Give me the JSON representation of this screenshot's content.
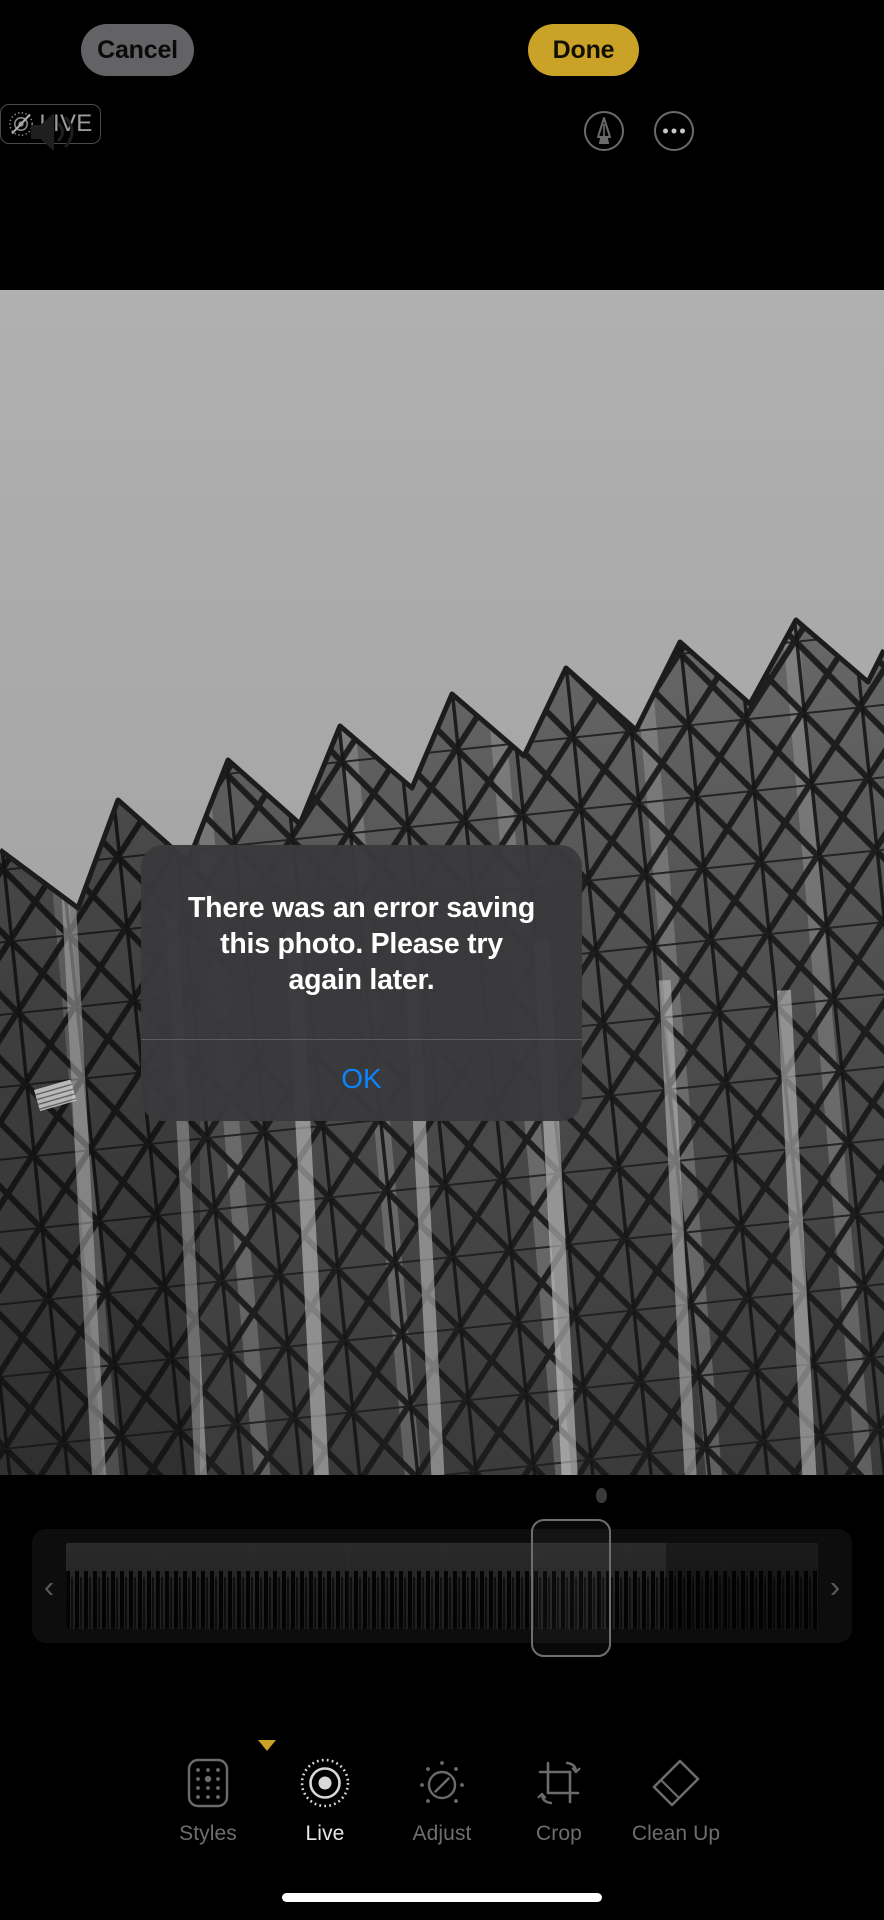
{
  "top_bar": {
    "cancel_label": "Cancel",
    "done_label": "Done",
    "cancel_color": "#636366",
    "done_color": "#c9a227",
    "speaker_icon": "speaker-wave-icon",
    "live_badge": {
      "label": "LIVE",
      "icon": "live-photo-off-icon"
    },
    "markup_icon": "markup-pen-circle-icon",
    "more_icon": "ellipsis-circle-icon"
  },
  "photo": {
    "description": "black-and-white photograph of a glass office building facade with sawtooth roofline",
    "sky_color": "#a9a9a9",
    "facade_color": "#4c4c4c",
    "mullion_color": "#1b1b1b"
  },
  "alert": {
    "message": "There was an error saving this photo. Please try again later.",
    "ok_label": "OK",
    "ok_color": "#0a84ff",
    "background_color": "#3a3a3c"
  },
  "filmstrip": {
    "left_arrow": "‹",
    "right_arrow": "›",
    "selector_name": "key-frame-selector",
    "playhead_name": "playhead-marker"
  },
  "tools": [
    {
      "label": "Styles",
      "icon": "styles-grid-icon",
      "active": false
    },
    {
      "label": "Live",
      "icon": "live-photo-icon",
      "active": true
    },
    {
      "label": "Adjust",
      "icon": "adjust-dial-icon",
      "active": false
    },
    {
      "label": "Crop",
      "icon": "crop-rotate-icon",
      "active": false
    },
    {
      "label": "Clean Up",
      "icon": "clean-up-eraser-icon",
      "active": false
    }
  ]
}
